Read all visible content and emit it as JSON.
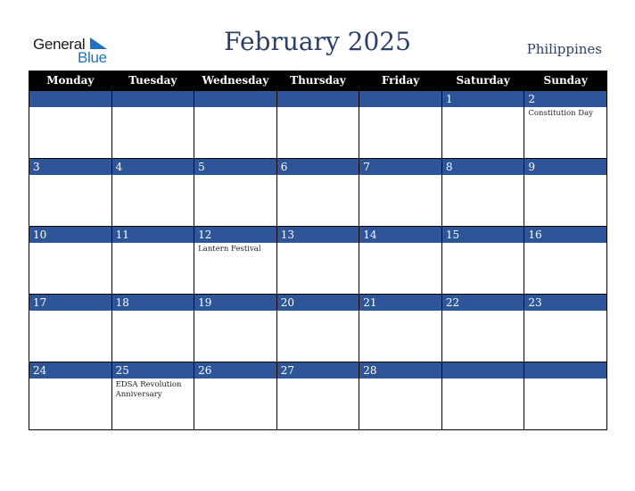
{
  "logo": {
    "line1": "General",
    "line2": "Blue",
    "accent_color": "#1f72c0"
  },
  "title": "February 2025",
  "country": "Philippines",
  "colors": {
    "header_bg": "#000000",
    "daynum_bg": "#2e5597",
    "title": "#2b3f6b"
  },
  "weekdays": [
    "Monday",
    "Tuesday",
    "Wednesday",
    "Thursday",
    "Friday",
    "Saturday",
    "Sunday"
  ],
  "weeks": [
    [
      {
        "day": "",
        "event": ""
      },
      {
        "day": "",
        "event": ""
      },
      {
        "day": "",
        "event": ""
      },
      {
        "day": "",
        "event": ""
      },
      {
        "day": "",
        "event": ""
      },
      {
        "day": "1",
        "event": ""
      },
      {
        "day": "2",
        "event": "Constitution Day"
      }
    ],
    [
      {
        "day": "3",
        "event": ""
      },
      {
        "day": "4",
        "event": ""
      },
      {
        "day": "5",
        "event": ""
      },
      {
        "day": "6",
        "event": ""
      },
      {
        "day": "7",
        "event": ""
      },
      {
        "day": "8",
        "event": ""
      },
      {
        "day": "9",
        "event": ""
      }
    ],
    [
      {
        "day": "10",
        "event": ""
      },
      {
        "day": "11",
        "event": ""
      },
      {
        "day": "12",
        "event": "Lantern Festival"
      },
      {
        "day": "13",
        "event": ""
      },
      {
        "day": "14",
        "event": ""
      },
      {
        "day": "15",
        "event": ""
      },
      {
        "day": "16",
        "event": ""
      }
    ],
    [
      {
        "day": "17",
        "event": ""
      },
      {
        "day": "18",
        "event": ""
      },
      {
        "day": "19",
        "event": ""
      },
      {
        "day": "20",
        "event": ""
      },
      {
        "day": "21",
        "event": ""
      },
      {
        "day": "22",
        "event": ""
      },
      {
        "day": "23",
        "event": ""
      }
    ],
    [
      {
        "day": "24",
        "event": ""
      },
      {
        "day": "25",
        "event": "EDSA Revolution Anniversary"
      },
      {
        "day": "26",
        "event": ""
      },
      {
        "day": "27",
        "event": ""
      },
      {
        "day": "28",
        "event": ""
      },
      {
        "day": "",
        "event": ""
      },
      {
        "day": "",
        "event": ""
      }
    ]
  ]
}
